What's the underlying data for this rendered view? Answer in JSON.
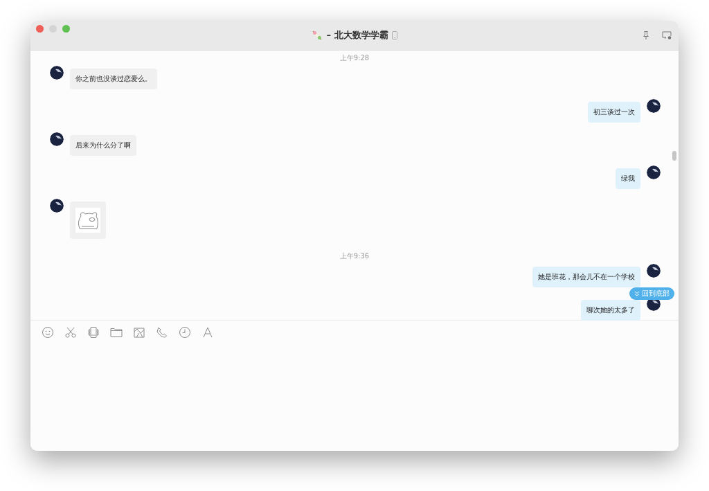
{
  "window": {
    "title": "– 北大数学学霸"
  },
  "messages": [
    {
      "kind": "time",
      "text": "上午9:28"
    },
    {
      "kind": "text",
      "outgoing": false,
      "text": "你之前也没谈过恋爱么。"
    },
    {
      "kind": "text",
      "outgoing": true,
      "text": "初三谈过一次"
    },
    {
      "kind": "text",
      "outgoing": false,
      "text": "后来为什么分了啊"
    },
    {
      "kind": "text",
      "outgoing": true,
      "text": "绿我"
    },
    {
      "kind": "sticker",
      "outgoing": false
    },
    {
      "kind": "time",
      "text": "上午9:36"
    },
    {
      "kind": "text",
      "outgoing": true,
      "text": "她是班花，那会儿不在一个学校"
    },
    {
      "kind": "text",
      "outgoing": true,
      "text": "聊次她的太多了"
    }
  ],
  "jump_button": {
    "label": "回到底部"
  }
}
